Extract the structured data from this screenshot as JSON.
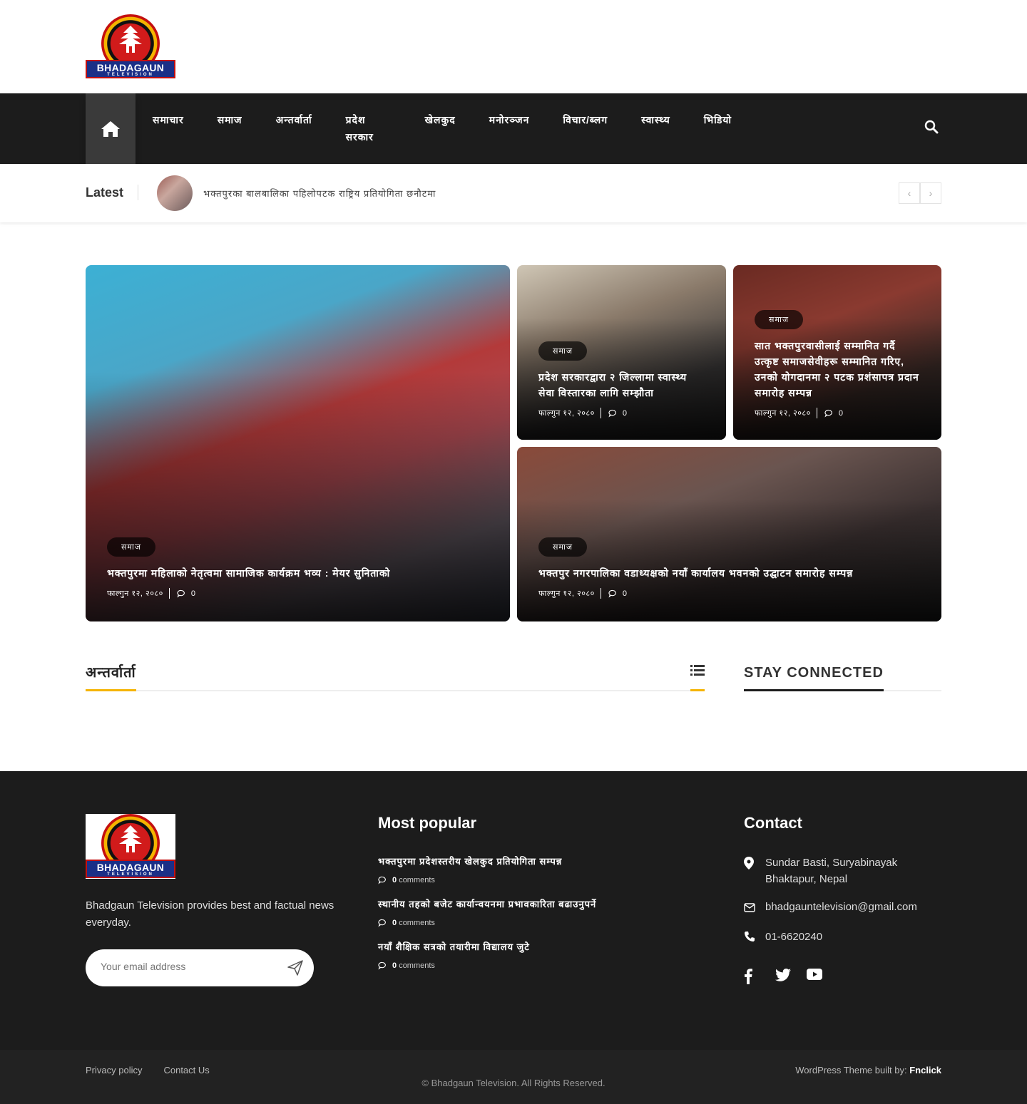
{
  "brand": {
    "logo_text": "BHADAGAUN",
    "logo_subtext": "TELEVISION"
  },
  "nav": {
    "home_label": "Home",
    "items": [
      "समाचार",
      "समाज",
      "अन्तर्वार्ता",
      "प्रदेश सरकार",
      "खेलकुद",
      "मनोरञ्जन",
      "विचार/ब्लग",
      "स्वास्थ्य",
      "भिडियो"
    ]
  },
  "ticker": {
    "label": "Latest",
    "headline": "भक्तपुरका बालबालिका पहिलोपटक राष्ट्रिय प्रतियोगिता छनौटमा",
    "prev": "‹",
    "next": "›"
  },
  "featured": [
    {
      "category": "समाज",
      "title": "भक्तपुरमा महिलाको नेतृत्वमा सामाजिक कार्यक्रम भव्य : मेयर सुनिताको",
      "date": "फाल्गुन १२, २०८०",
      "comments": "0"
    },
    {
      "category": "समाज",
      "title": "प्रदेश सरकारद्वारा २ जिल्लामा स्वास्थ्य सेवा विस्तारका लागि सम्झौता",
      "date": "फाल्गुन १२, २०८०",
      "comments": "0"
    },
    {
      "category": "समाज",
      "title": "सात भक्तपुरवासीलाई सम्मानित गर्दै उत्कृष्ट समाजसेवीहरू सम्मानित गरिए, उनको योगदानमा २ पटक प्रशंसापत्र प्रदान समारोह सम्पन्न",
      "date": "फाल्गुन १२, २०८०",
      "comments": "0"
    },
    {
      "category": "समाज",
      "title": "भक्तपुर नगरपालिका वडाध्यक्षको नयाँ कार्यालय भवनको उद्घाटन समारोह सम्पन्न",
      "date": "फाल्गुन १२, २०८०",
      "comments": "0"
    }
  ],
  "sections": {
    "left_title": "अन्तर्वार्ता",
    "right_title": "STAY CONNECTED"
  },
  "footer": {
    "description": "Bhadgaun Television provides best and factual news everyday.",
    "email_placeholder": "Your email address",
    "popular_title": "Most popular",
    "popular": [
      {
        "title": "भक्तपुरमा प्रदेशस्तरीय खेलकुद प्रतियोगिता सम्पन्न",
        "count": "0",
        "suffix": "comments"
      },
      {
        "title": "स्थानीय तहको बजेट कार्यान्वयनमा प्रभावकारिता बढाउनुपर्ने",
        "count": "0",
        "suffix": "comments"
      },
      {
        "title": "नयाँ शैक्षिक सत्रको तयारीमा विद्यालय जुटे",
        "count": "0",
        "suffix": "comments"
      }
    ],
    "contact_title": "Contact",
    "address": "Sundar Basti, Suryabinayak Bhaktapur, Nepal",
    "email": "bhadgauntelevision@gmail.com",
    "phone": "01-6620240"
  },
  "bottom": {
    "privacy": "Privacy policy",
    "contact_us": "Contact Us",
    "copyright": "© Bhadgaun Television. All Rights Reserved.",
    "credit_prefix": "WordPress Theme built by:",
    "credit_name": "Fnclick"
  },
  "colors": {
    "accent": "#f5b400",
    "nav_bg": "#1c1c1c",
    "footer_bg": "#1c1c1c"
  }
}
